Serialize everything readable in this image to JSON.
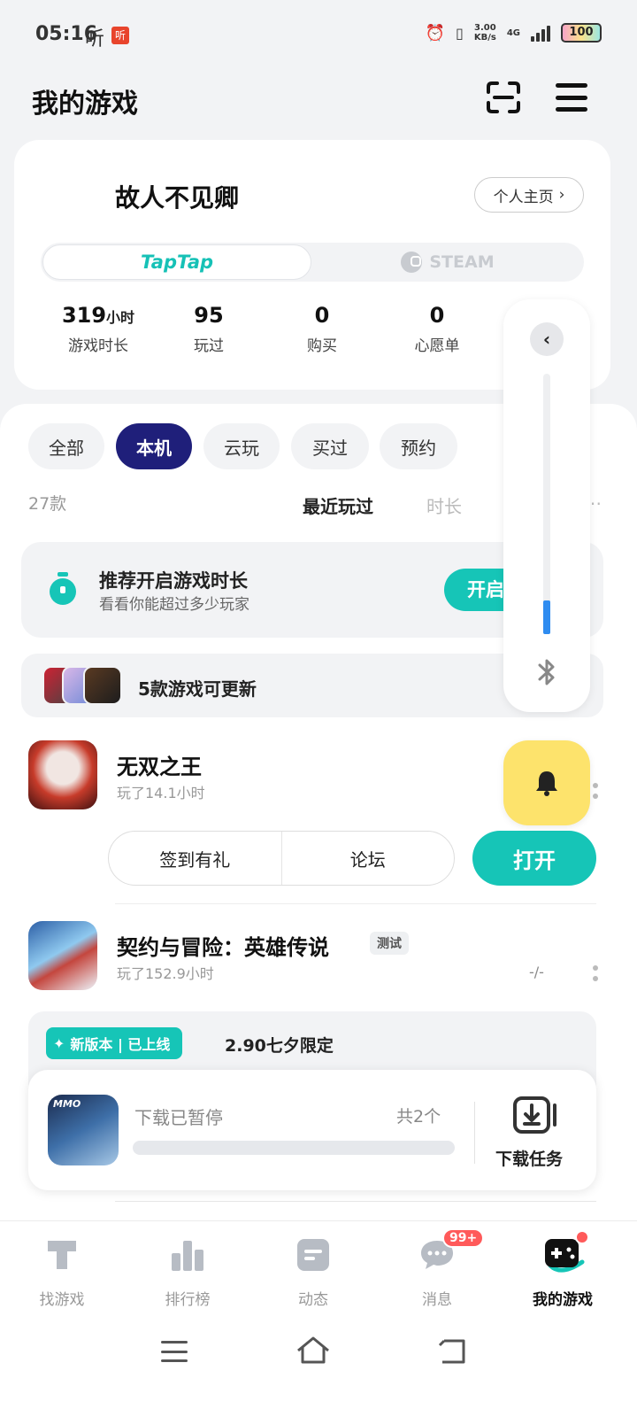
{
  "status_bar": {
    "time": "05:16",
    "listen": "听",
    "app_badge": "听",
    "speed_value": "3.00",
    "speed_unit": "KB/s",
    "network": "4G",
    "battery": "100"
  },
  "header": {
    "title": "我的游戏"
  },
  "profile": {
    "username": "故人不见卿",
    "homepage_label": "个人主页",
    "platforms": [
      "TapTap",
      "STEAM"
    ],
    "active_platform": "TapTap",
    "stats": [
      {
        "value": "319",
        "unit": "小时",
        "label": "游戏时长"
      },
      {
        "value": "95",
        "unit": "",
        "label": "玩过"
      },
      {
        "value": "0",
        "unit": "",
        "label": "购买"
      },
      {
        "value": "0",
        "unit": "",
        "label": "心愿单"
      }
    ]
  },
  "side_panel": {
    "level": 0.13
  },
  "filters": {
    "tabs": [
      "全部",
      "本机",
      "云玩",
      "买过",
      "预约"
    ],
    "active": "本机",
    "count": "27款",
    "sort_options": [
      "最近玩过",
      "时长",
      "⋯"
    ]
  },
  "recommend": {
    "title": "推荐开启游戏时长",
    "subtitle": "看看你能超过多少玩家",
    "button": "开启"
  },
  "updates": {
    "text": "5款游戏可更新"
  },
  "games": [
    {
      "name": "无双之王",
      "play_time": "玩了14.1小时",
      "actions": [
        "签到有礼",
        "论坛"
      ],
      "open_label": "打开"
    },
    {
      "name": "契约与冒险：英雄传说",
      "tag": "测试",
      "play_time": "玩了152.9小时",
      "status": "-/-",
      "version_badge": "新版本 | 已上线",
      "version_text": "2.90七夕限定"
    }
  ],
  "download": {
    "icon_text": "MMO",
    "title": "下载已暂停",
    "count": "共2个",
    "task_label": "下载任务",
    "progress": 0.0
  },
  "bottom_nav": {
    "items": [
      "找游戏",
      "排行榜",
      "动态",
      "消息",
      "我的游戏"
    ],
    "active": "我的游戏",
    "message_badge": "99+"
  },
  "colors": {
    "accent": "#16c5b7",
    "active_chip": "#1f1f7a",
    "bell": "#fde36c",
    "badge": "#ff5a5a"
  }
}
